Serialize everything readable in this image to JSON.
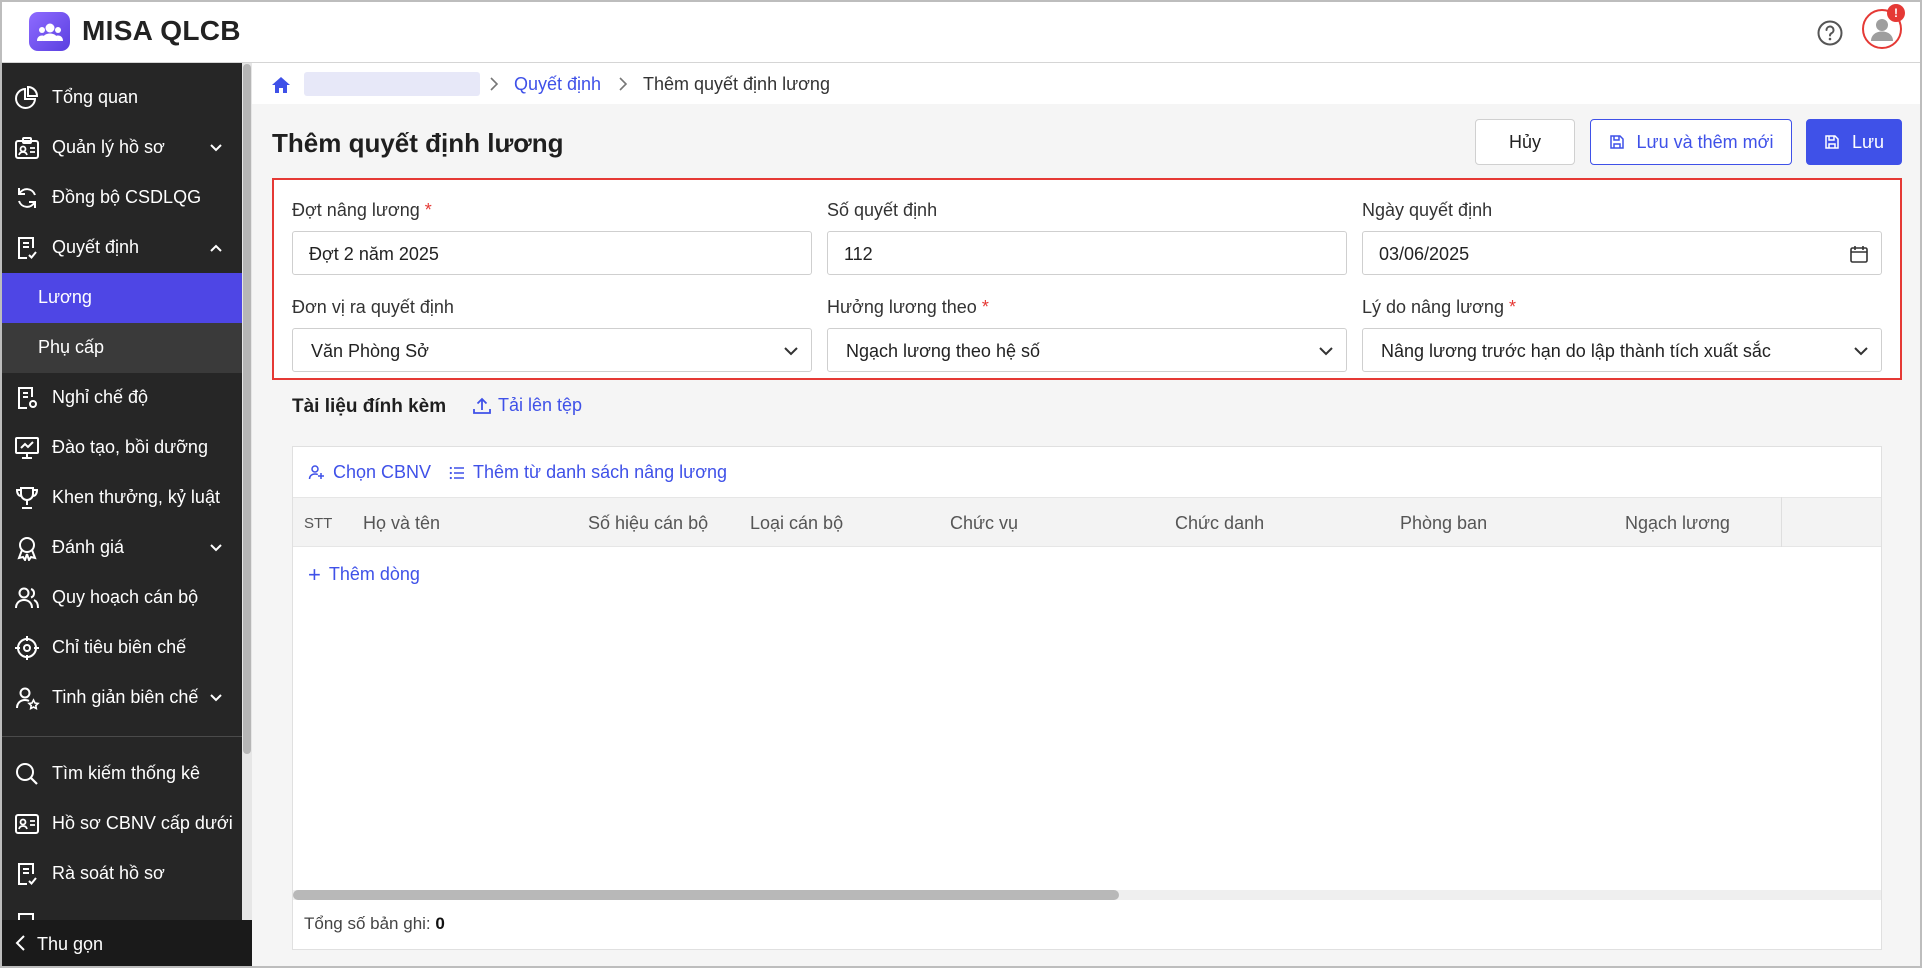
{
  "app": {
    "title": "MISA QLCB",
    "notification_badge": "!"
  },
  "sidebar": {
    "items": [
      {
        "label": "Tổng quan"
      },
      {
        "label": "Quản lý hồ sơ"
      },
      {
        "label": "Đồng bộ CSDLQG"
      },
      {
        "label": "Quyết định"
      },
      {
        "label": "Nghỉ chế độ"
      },
      {
        "label": "Đào tạo, bồi dưỡng"
      },
      {
        "label": "Khen thưởng, kỷ luật"
      },
      {
        "label": "Đánh giá"
      },
      {
        "label": "Quy hoạch cán bộ"
      },
      {
        "label": "Chỉ tiêu biên chế"
      },
      {
        "label": "Tinh giản biên chế"
      },
      {
        "label": "Tìm kiếm thống kê"
      },
      {
        "label": "Hồ sơ CBNV cấp dưới"
      },
      {
        "label": "Rà soát hồ sơ"
      }
    ],
    "subitems": [
      {
        "label": "Lương"
      },
      {
        "label": "Phụ cấp"
      }
    ],
    "collapse_label": "Thu gọn"
  },
  "breadcrumb": {
    "link": "Quyết định",
    "current": "Thêm quyết định lương"
  },
  "page": {
    "title": "Thêm quyết định lương"
  },
  "actions": {
    "cancel": "Hủy",
    "save_new": "Lưu và thêm mới",
    "save": "Lưu"
  },
  "form": {
    "required_mark": "*",
    "dot_nang_luong": {
      "label": "Đợt nâng lương",
      "value": "Đợt 2 năm 2025"
    },
    "so_quyet_dinh": {
      "label": "Số quyết định",
      "value": "112"
    },
    "ngay_quyet_dinh": {
      "label": "Ngày quyết định",
      "value": "03/06/2025"
    },
    "don_vi": {
      "label": "Đơn vị ra quyết định",
      "value": "Văn Phòng Sở"
    },
    "huong_luong": {
      "label": "Hưởng lương theo",
      "value": "Ngạch lương theo hệ số"
    },
    "ly_do": {
      "label": "Lý do nâng lương",
      "value": "Nâng lương trước hạn do lập thành tích xuất sắc"
    }
  },
  "attachments": {
    "title": "Tài liệu đính kèm",
    "upload": "Tải lên tệp"
  },
  "grid": {
    "tools": {
      "choose": "Chọn CBNV",
      "add_from_list": "Thêm từ danh sách nâng lương"
    },
    "columns": [
      "STT",
      "Họ và tên",
      "Số hiệu cán bộ",
      "Loại cán bộ",
      "Chức vụ",
      "Chức danh",
      "Phòng ban",
      "Ngạch lương"
    ],
    "add_row": "Thêm dòng",
    "total_label": "Tổng số bản ghi:",
    "total_value": "0"
  },
  "colors": {
    "accent": "#3f51e8",
    "sidebar_bg": "#262626",
    "active_item": "#4e46e5",
    "error": "#e53935"
  }
}
